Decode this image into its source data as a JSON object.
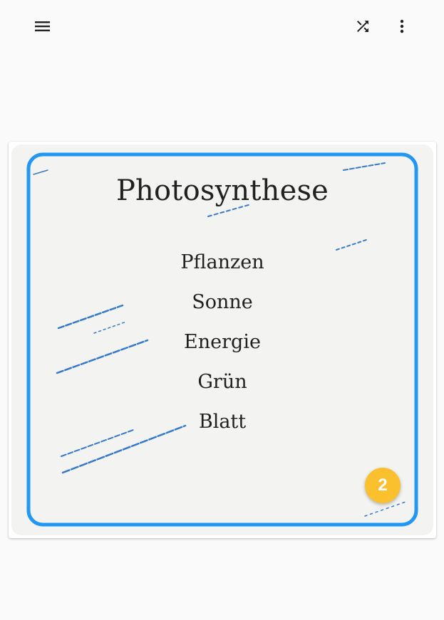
{
  "toolbar": {
    "menu_icon": "menu-icon",
    "shuffle_icon": "shuffle-icon",
    "more_icon": "more-vert-icon"
  },
  "card": {
    "title": "Photosynthese",
    "words": [
      "Pflanzen",
      "Sonne",
      "Energie",
      "Grün",
      "Blatt"
    ],
    "badge": "2",
    "border_color": "#2196f3",
    "badge_color": "#fbc02d"
  }
}
